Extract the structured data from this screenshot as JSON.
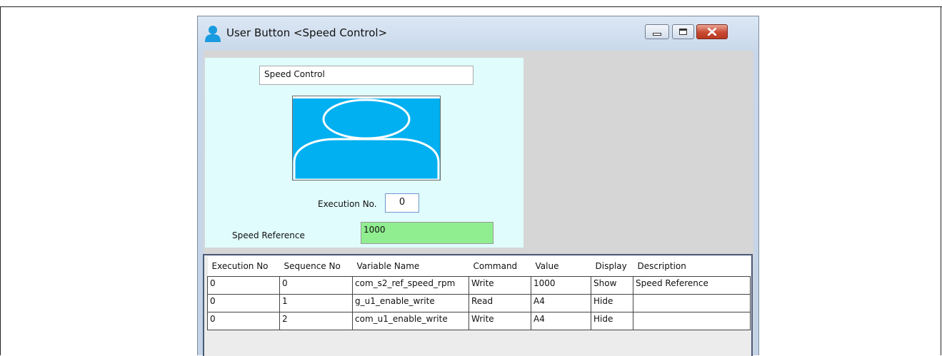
{
  "window": {
    "title": "User Button <Speed Control>",
    "icon": "user-icon",
    "controls": {
      "minimize": "minimize-icon",
      "maximize": "maximize-icon",
      "close": "close-icon"
    }
  },
  "panel": {
    "button_name": "Speed Control",
    "execution_label": "Execution No.",
    "execution_value": "0",
    "speed_label": "Speed Reference",
    "speed_value": "1000",
    "speed_value_color": "#90ee90",
    "panel_color": "#e0fcfc",
    "avatar_color": "#00b0f0"
  },
  "table": {
    "columns": [
      "Execution No",
      "Sequence No",
      "Variable Name",
      "Command",
      "Value",
      "Display",
      "Description"
    ],
    "rows": [
      [
        "0",
        "0",
        "com_s2_ref_speed_rpm",
        "Write",
        "1000",
        "Show",
        "Speed Reference"
      ],
      [
        "0",
        "1",
        "g_u1_enable_write",
        "Read",
        "A4",
        "Hide",
        ""
      ],
      [
        "0",
        "2",
        "com_u1_enable_write",
        "Write",
        "A4",
        "Hide",
        ""
      ]
    ]
  }
}
